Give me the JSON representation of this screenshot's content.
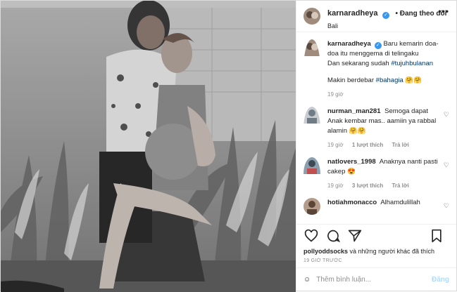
{
  "post": {
    "author": "karnaradheya",
    "follow_label": "• Đang theo dõi",
    "location": "Bali",
    "more_label": "•••"
  },
  "caption": {
    "author": "karnaradheya",
    "line1": "Baru kemarin doa-doa itu menggema di telingaku",
    "line2_prefix": "Dan sekarang sudah",
    "hashtag1": "#tujuhbulanan",
    "line3_prefix": "Makin berdebar",
    "hashtag2": "#bahagia",
    "emojis": "🤗🤗",
    "time": "19 giờ"
  },
  "comments": [
    {
      "user": "nurman_man281",
      "text": "Semoga dapat Anak kembar mas.. aamiin ya rabbal alamin 🤗🤗",
      "time": "19 giờ",
      "likes": "1 lượt thích",
      "reply": "Trả lời"
    },
    {
      "user": "natlovers_1998",
      "text": "Anaknya nanti pasti cakep 😍",
      "time": "19 giờ",
      "likes": "3 lượt thích",
      "reply": "Trả lời"
    },
    {
      "user": "hotiahmonacco",
      "text": "Alhamdulillah",
      "time": "",
      "likes": "",
      "reply": ""
    }
  ],
  "likes_line": {
    "user": "pollyoddsocks",
    "rest": "và những người khác đã thích"
  },
  "post_time": "19 GIỜ TRƯỚC",
  "add_comment": {
    "placeholder": "Thêm bình luận...",
    "post_label": "Đăng"
  },
  "colors": {
    "verified": "#3897f0",
    "hashtag": "#003569",
    "post_button": "#b3dbff"
  },
  "icons": [
    "heart-icon",
    "comment-icon",
    "share-icon",
    "bookmark-icon",
    "emoji-icon",
    "verified-icon"
  ]
}
